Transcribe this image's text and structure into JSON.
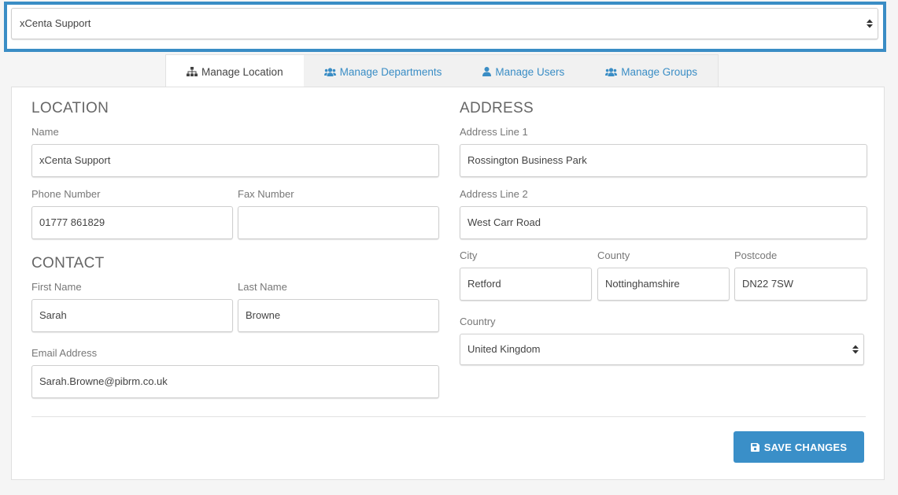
{
  "location_selector": {
    "value": "xCenta Support",
    "caret_icon": "sort-caret-icon"
  },
  "tabs": [
    {
      "label": "Manage Location",
      "icon": "sitemap-icon",
      "active": true
    },
    {
      "label": "Manage Departments",
      "icon": "users-icon",
      "active": false
    },
    {
      "label": "Manage Users",
      "icon": "user-icon",
      "active": false
    },
    {
      "label": "Manage Groups",
      "icon": "users-icon",
      "active": false
    }
  ],
  "location": {
    "heading": "LOCATION",
    "name_label": "Name",
    "name_value": "xCenta Support",
    "phone_label": "Phone Number",
    "phone_value": "01777 861829",
    "fax_label": "Fax Number",
    "fax_value": ""
  },
  "contact": {
    "heading": "CONTACT",
    "first_name_label": "First Name",
    "first_name_value": "Sarah",
    "last_name_label": "Last Name",
    "last_name_value": "Browne",
    "email_label": "Email Address",
    "email_value": "Sarah.Browne@pibrm.co.uk"
  },
  "address": {
    "heading": "ADDRESS",
    "line1_label": "Address Line 1",
    "line1_value": "Rossington Business Park",
    "line2_label": "Address Line 2",
    "line2_value": "West Carr Road",
    "city_label": "City",
    "city_value": "Retford",
    "county_label": "County",
    "county_value": "Nottinghamshire",
    "postcode_label": "Postcode",
    "postcode_value": "DN22 7SW",
    "country_label": "Country",
    "country_value": "United Kingdom"
  },
  "save_button": {
    "label": "SAVE CHANGES",
    "icon": "floppy-disk-icon"
  },
  "colors": {
    "accent": "#3a8dc5",
    "button": "#3a8fc8",
    "frame": "#3a8dc5"
  }
}
